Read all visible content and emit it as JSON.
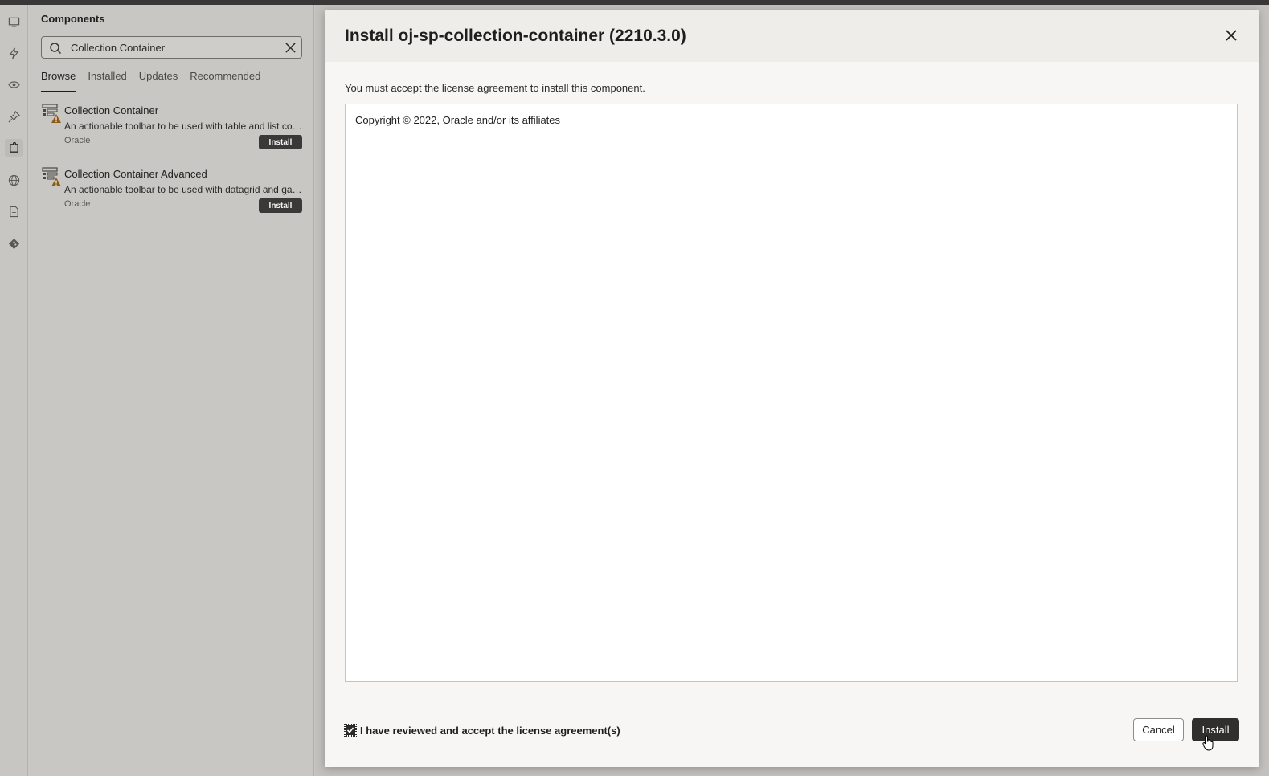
{
  "panel": {
    "title": "Components",
    "search": {
      "value": "Collection Container",
      "placeholder": "Search"
    },
    "tabs": [
      {
        "label": "Browse",
        "active": true
      },
      {
        "label": "Installed",
        "active": false
      },
      {
        "label": "Updates",
        "active": false
      },
      {
        "label": "Recommended",
        "active": false
      }
    ],
    "results": [
      {
        "name": "Collection Container",
        "description": "An actionable toolbar to be used with table and list collections",
        "vendor": "Oracle",
        "action": "Install",
        "icon": "component-warning-icon"
      },
      {
        "name": "Collection Container Advanced",
        "description": "An actionable toolbar to be used with datagrid and gantt components",
        "vendor": "Oracle",
        "action": "Install",
        "icon": "component-warning-icon"
      }
    ]
  },
  "rail": {
    "icons": [
      "monitor-icon",
      "lightning-icon",
      "eye-icon",
      "pin-icon",
      "puzzle-icon",
      "globe-icon",
      "document-icon",
      "git-icon"
    ],
    "active": "puzzle-icon"
  },
  "dialog": {
    "title": "Install oj-sp-collection-container (2210.3.0)",
    "notice": "You must accept the license agreement to install this component.",
    "license_text": "Copyright © 2022, Oracle and/or its affiliates",
    "accept_label": "I have reviewed and accept the license agreement(s)",
    "accept_checked": true,
    "cancel_label": "Cancel",
    "install_label": "Install"
  },
  "colors": {
    "primary_button": "#312f2d",
    "warning": "#8a5a1a"
  }
}
